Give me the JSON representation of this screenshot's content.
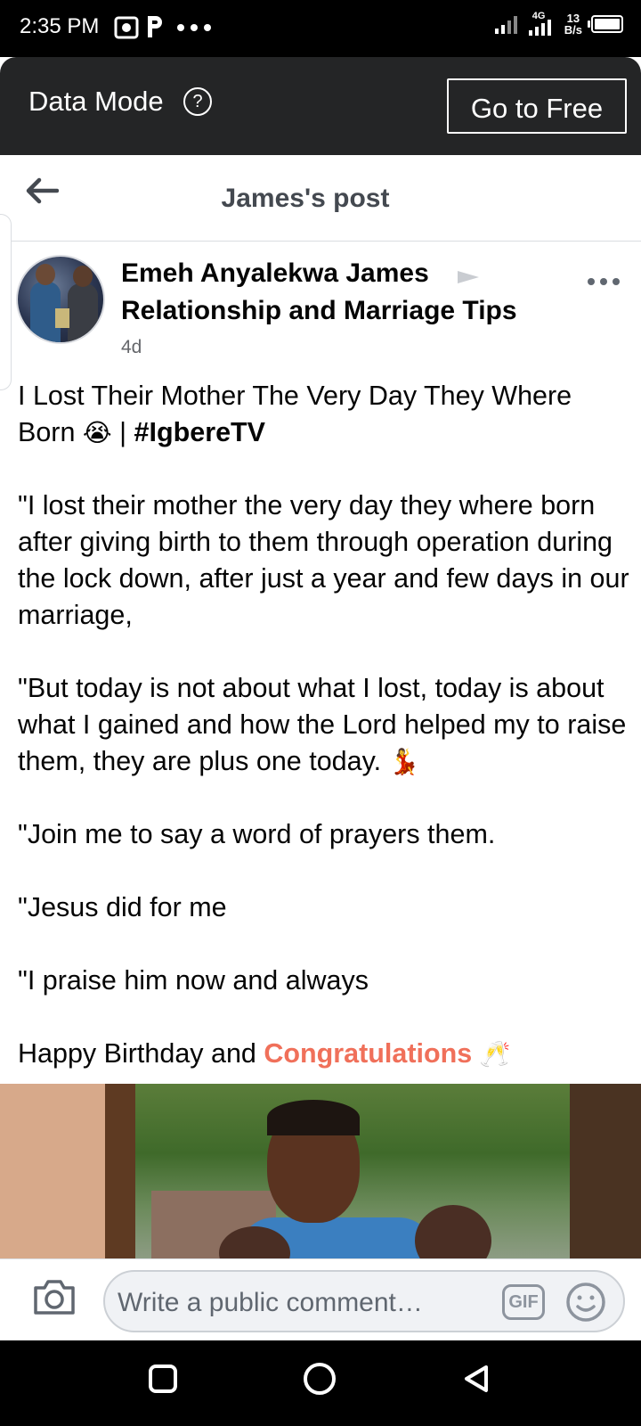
{
  "status_bar": {
    "time": "2:35 PM",
    "network_label": "4G",
    "speed_value": "13",
    "speed_unit": "B/s",
    "notification_icons": [
      "photo-icon",
      "pocket-p-icon",
      "more-dots-icon"
    ]
  },
  "data_mode_bar": {
    "label": "Data Mode",
    "help_symbol": "?",
    "go_free_label": "Go to Free"
  },
  "header": {
    "title": "James's post"
  },
  "post": {
    "author": "Emeh Anyalekwa James",
    "group": "Relationship and Marriage Tips",
    "time": "4d",
    "title_line": "I Lost Their Mother The Very Day They Where Born",
    "title_emoji": "😭",
    "separator": "|",
    "hashtag": "#IgbereTV",
    "para1": "\"I lost their mother the very day they where born after giving birth to them through operation during the lock down, after just a year and few days in our marriage,",
    "para2": "\"But today is not about what I lost, today is about what I gained and how the Lord helped my to raise them, they are plus one today.",
    "para2_emoji": "💃",
    "para3": "\"Join me to say a word of prayers them.",
    "para4": "\"Jesus did for me",
    "para5": "\"I praise him now and always",
    "closing_text": "Happy Birthday and",
    "closing_highlight": "Congratulations",
    "closing_emoji": "🥂"
  },
  "comment_bar": {
    "placeholder": "Write a public comment…",
    "gif_label": "GIF"
  },
  "colors": {
    "accent_highlight": "#f0705a",
    "data_bar_bg": "#242526",
    "title_gray": "#444950"
  }
}
